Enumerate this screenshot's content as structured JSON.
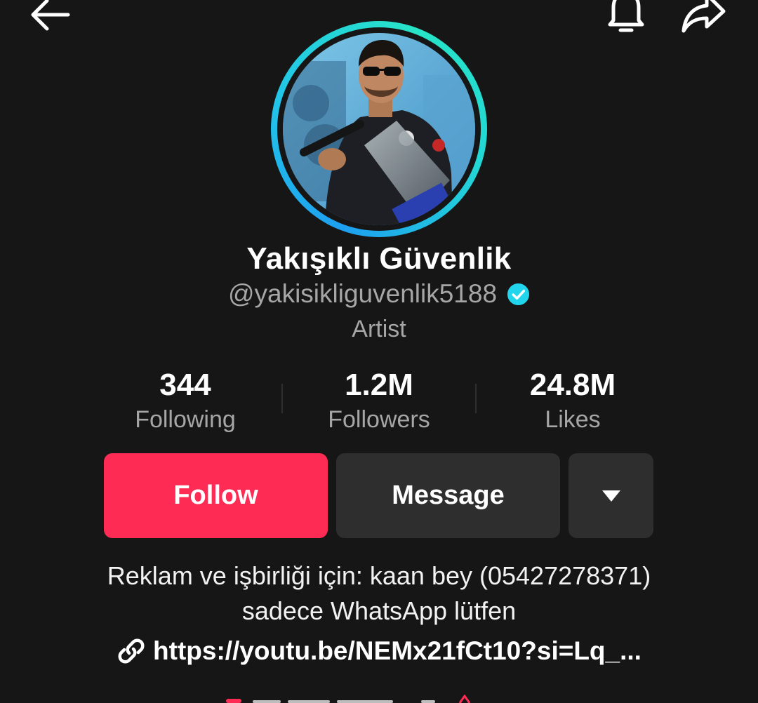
{
  "topbar": {
    "back_icon": "arrow-left-icon",
    "notification_icon": "bell-icon",
    "share_icon": "share-arrow-icon"
  },
  "profile": {
    "display_name": "Yakışıklı Güvenlik",
    "handle": "@yakisikliguvenlik5188",
    "verified": true,
    "category": "Artist",
    "avatar_ring_colors": [
      "#1ea0f0",
      "#27e4c7"
    ]
  },
  "stats": [
    {
      "value": "344",
      "label": "Following"
    },
    {
      "value": "1.2M",
      "label": "Followers"
    },
    {
      "value": "24.8M",
      "label": "Likes"
    }
  ],
  "actions": {
    "follow_label": "Follow",
    "message_label": "Message",
    "more_icon": "caret-down-icon"
  },
  "bio": {
    "line1": "Reklam ve işbirliği için: kaan bey (05427278371)",
    "line2": "sadece WhatsApp lütfen"
  },
  "link": {
    "text": "https://youtu.be/NEMx21fCt10?si=Lq_...",
    "icon": "link-icon"
  },
  "colors": {
    "background": "#161616",
    "follow": "#fe2c55",
    "secondary_button": "#2e2e2e",
    "muted_text": "#a6a6a6",
    "verified": "#20d5ec"
  }
}
